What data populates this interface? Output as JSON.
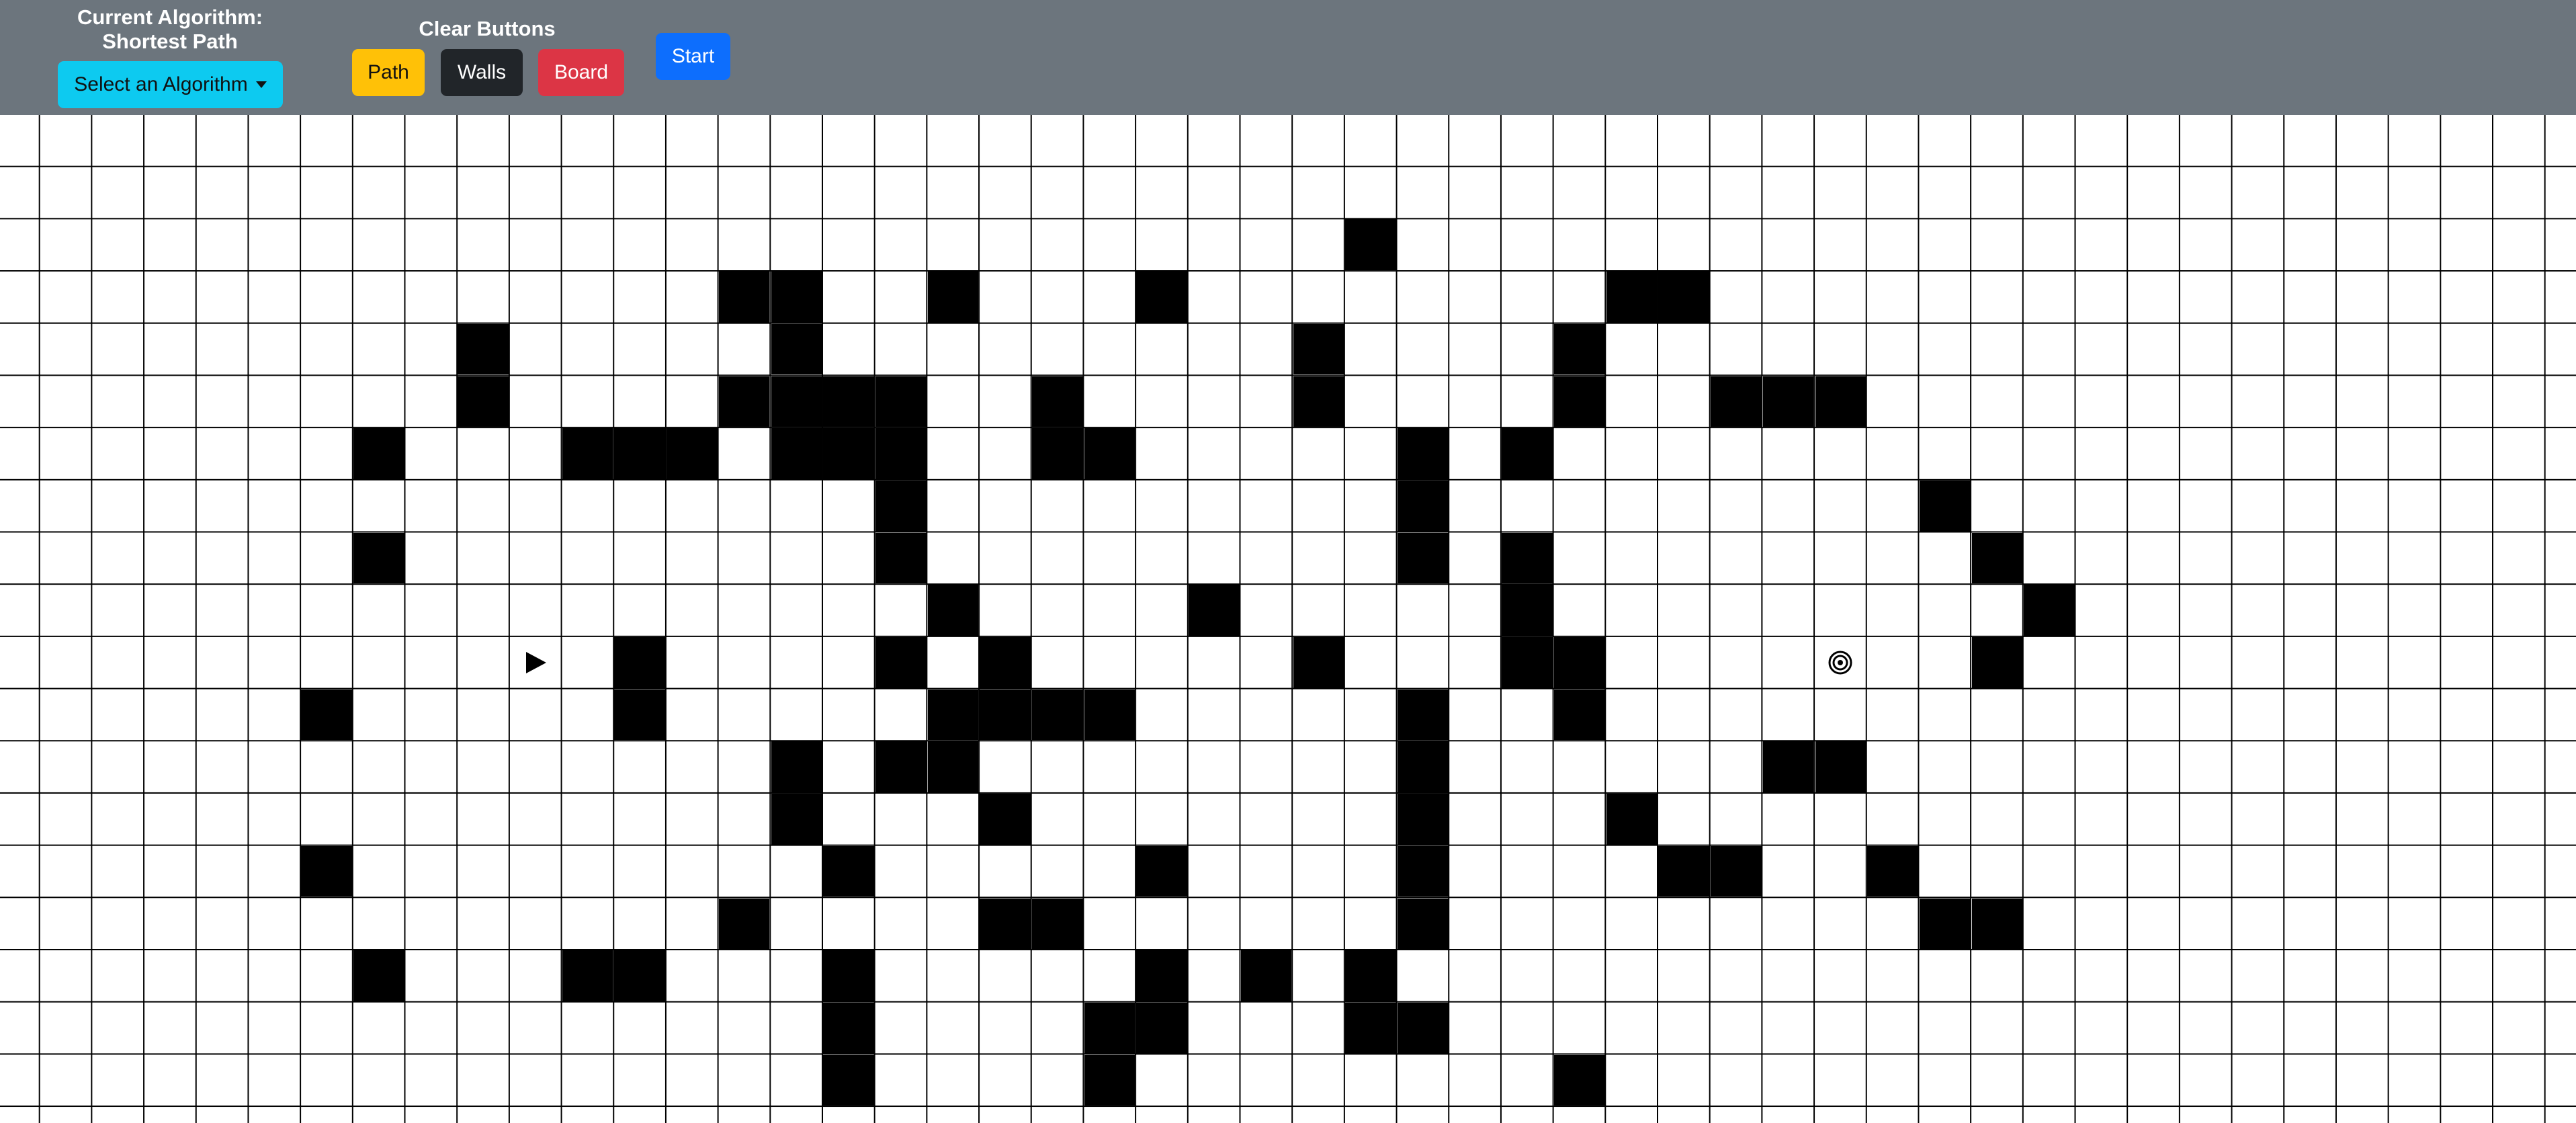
{
  "header": {
    "algorithm_label": "Current Algorithm: Shortest Path",
    "algorithm_dropdown_label": "Select an Algorithm",
    "clear_label": "Clear Buttons",
    "clear_buttons": {
      "path": "Path",
      "walls": "Walls",
      "board": "Board"
    },
    "start_label": "Start"
  },
  "colors": {
    "topbar": "#6c757d",
    "dropdown": "#0dcaf0",
    "path_button": "#ffc107",
    "walls_button": "#212529",
    "board_button": "#dc3545",
    "start_button": "#0d6efd",
    "wall": "#000000"
  },
  "grid": {
    "start_icon": "play-triangle-icon",
    "target_icon": "bullseye-target-icon",
    "start_node": [
      10,
      10
    ],
    "target_node": [
      10,
      35
    ],
    "walls": [
      [
        2,
        26
      ],
      [
        3,
        14
      ],
      [
        3,
        15
      ],
      [
        3,
        18
      ],
      [
        3,
        22
      ],
      [
        3,
        31
      ],
      [
        3,
        32
      ],
      [
        4,
        9
      ],
      [
        4,
        15
      ],
      [
        4,
        25
      ],
      [
        4,
        30
      ],
      [
        5,
        9
      ],
      [
        5,
        14
      ],
      [
        5,
        15
      ],
      [
        5,
        16
      ],
      [
        5,
        17
      ],
      [
        5,
        20
      ],
      [
        5,
        25
      ],
      [
        5,
        30
      ],
      [
        5,
        33
      ],
      [
        5,
        34
      ],
      [
        5,
        35
      ],
      [
        6,
        7
      ],
      [
        6,
        11
      ],
      [
        6,
        12
      ],
      [
        6,
        13
      ],
      [
        6,
        15
      ],
      [
        6,
        16
      ],
      [
        6,
        17
      ],
      [
        6,
        20
      ],
      [
        6,
        21
      ],
      [
        6,
        27
      ],
      [
        6,
        29
      ],
      [
        7,
        17
      ],
      [
        7,
        27
      ],
      [
        7,
        37
      ],
      [
        8,
        7
      ],
      [
        8,
        17
      ],
      [
        8,
        27
      ],
      [
        8,
        29
      ],
      [
        8,
        38
      ],
      [
        9,
        18
      ],
      [
        9,
        23
      ],
      [
        9,
        29
      ],
      [
        9,
        39
      ],
      [
        10,
        12
      ],
      [
        10,
        17
      ],
      [
        10,
        19
      ],
      [
        10,
        25
      ],
      [
        10,
        29
      ],
      [
        10,
        30
      ],
      [
        10,
        38
      ],
      [
        11,
        6
      ],
      [
        11,
        12
      ],
      [
        11,
        18
      ],
      [
        11,
        19
      ],
      [
        11,
        20
      ],
      [
        11,
        21
      ],
      [
        11,
        27
      ],
      [
        11,
        30
      ],
      [
        12,
        15
      ],
      [
        12,
        17
      ],
      [
        12,
        18
      ],
      [
        12,
        27
      ],
      [
        12,
        34
      ],
      [
        12,
        35
      ],
      [
        13,
        15
      ],
      [
        13,
        19
      ],
      [
        13,
        27
      ],
      [
        13,
        31
      ],
      [
        14,
        6
      ],
      [
        14,
        16
      ],
      [
        14,
        22
      ],
      [
        14,
        27
      ],
      [
        14,
        32
      ],
      [
        14,
        33
      ],
      [
        14,
        36
      ],
      [
        15,
        14
      ],
      [
        15,
        19
      ],
      [
        15,
        20
      ],
      [
        15,
        27
      ],
      [
        15,
        37
      ],
      [
        15,
        38
      ],
      [
        16,
        7
      ],
      [
        16,
        11
      ],
      [
        16,
        12
      ],
      [
        16,
        16
      ],
      [
        16,
        22
      ],
      [
        16,
        24
      ],
      [
        16,
        26
      ],
      [
        17,
        16
      ],
      [
        17,
        21
      ],
      [
        17,
        22
      ],
      [
        17,
        26
      ],
      [
        17,
        27
      ],
      [
        18,
        16
      ],
      [
        18,
        21
      ],
      [
        18,
        30
      ]
    ]
  }
}
